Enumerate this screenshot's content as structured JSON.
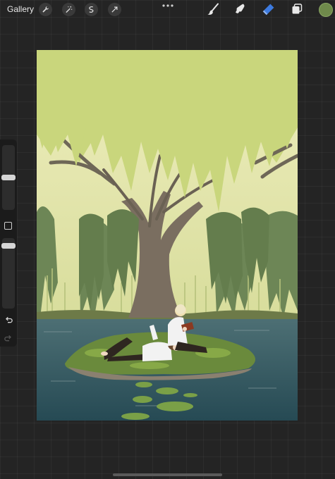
{
  "toolbar": {
    "gallery_label": "Gallery",
    "left_tools": [
      "wrench-icon",
      "magic-wand-icon",
      "selection-icon",
      "transform-arrow-icon"
    ],
    "right_tools": [
      "brush-icon",
      "smudge-icon",
      "eraser-icon",
      "layers-icon"
    ],
    "active_tool": "eraser-icon",
    "current_color": "#6f8a4b"
  },
  "sidebar": {
    "brush_size_level": 0.5,
    "opacity_level": 0.2
  },
  "colors": {
    "sky": "#c9d67c",
    "accent_blue": "#3d7be0"
  }
}
